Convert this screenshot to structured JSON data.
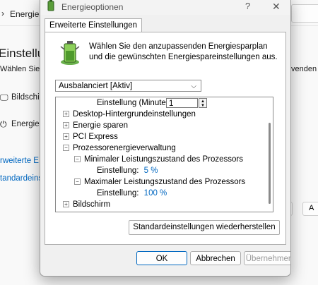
{
  "background": {
    "title": "Energiesp",
    "heading": "Einstellun",
    "subtext": "Wählen Sie d",
    "subtext_right": "venden n",
    "item1": "Bildschirm",
    "item2": "Energies",
    "link1": "rweiterte E",
    "link2": "tandardeins",
    "btn_right": "A"
  },
  "dialog": {
    "title": "Energieoptionen",
    "help": "?",
    "close": "✕",
    "tab": "Erweiterte Einstellungen",
    "description": "Wählen Sie den anzupassenden Energiesparplan und die gewünschten Energiespareinstellungen aus.",
    "plan_selected": "Ausbalanciert [Aktiv]",
    "tree": {
      "minute_label": "Einstellung (Minute):",
      "minute_value": "1",
      "items": [
        {
          "label": "Desktop-Hintergrundeinstellungen",
          "toggle": "+"
        },
        {
          "label": "Energie sparen",
          "toggle": "+"
        },
        {
          "label": "PCI Express",
          "toggle": "+"
        },
        {
          "label": "Prozessorenergieverwaltung",
          "toggle": "−"
        },
        {
          "label": "Minimaler Leistungszustand des Prozessors",
          "toggle": "−"
        },
        {
          "label": "Maximaler Leistungszustand des Prozessors",
          "toggle": "−"
        },
        {
          "label": "Bildschirm",
          "toggle": "+"
        }
      ],
      "setting_label": "Einstellung:",
      "min_value": "5 %",
      "max_value": "100 %"
    },
    "restore_button": "Standardeinstellungen wiederherstellen",
    "ok": "OK",
    "cancel": "Abbrechen",
    "apply": "Übernehmen"
  }
}
